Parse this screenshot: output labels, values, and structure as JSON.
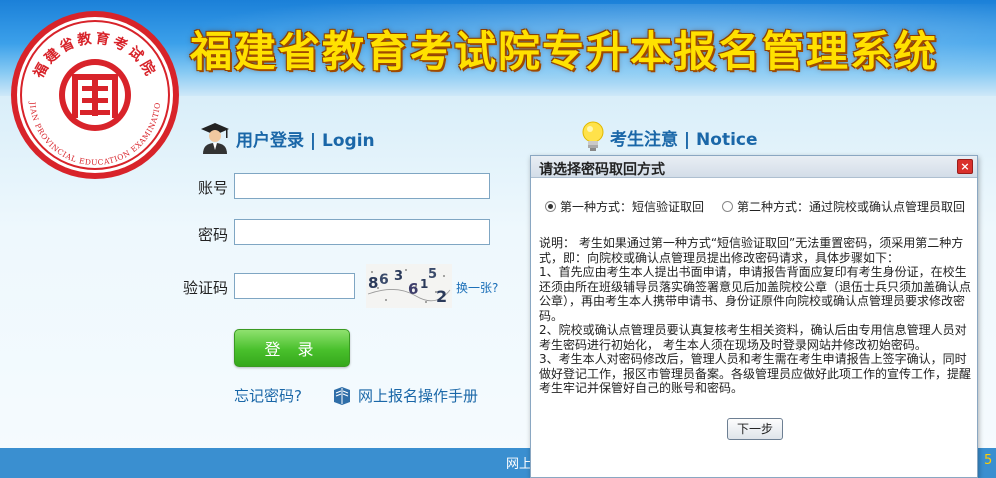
{
  "header": {
    "title": "福建省教育考试院专升本报名管理系统",
    "seal_text": "福建省教育考试院",
    "seal_text_en": "FUJIAN PROVINCIAL EDUCATION EXAMINATIONS"
  },
  "login": {
    "title": "用户登录 | Login",
    "account_label": "账号",
    "account_value": "",
    "password_label": "密码",
    "password_value": "",
    "captcha_label": "验证码",
    "captcha_value": "",
    "captcha_text": "8636152",
    "refresh_label": "换一张?",
    "submit_label": "登 录",
    "forgot_label": "忘记密码?",
    "manual_label": "网上报名操作手册"
  },
  "notice": {
    "title": "考生注意 | Notice"
  },
  "footer": {
    "text": "网上",
    "tail": "5"
  },
  "dialog": {
    "title": "请选择密码取回方式",
    "close_label": "×",
    "option1": "第一种方式：短信验证取回",
    "option2": "第二种方式：通过院校或确认点管理员取回",
    "selected": "option1",
    "body": [
      "说明：  考生如果通过第一种方式“短信验证取回”无法重置密码，须采用第二种方式，即：向院校或确认点管理员提出修改密码请求，具体步骤如下：",
      "1、首先应由考生本人提出书面申请，申请报告背面应复印有考生身份证，在校生还须由所在班级辅导员落实确签署意见后加盖院校公章（退伍士兵只须加盖确认点公章），再由考生本人携带申请书、身份证原件向院校或确认点管理员要求修改密码。",
      "2、院校或确认点管理员要认真复核考生相关资料，确认后由专用信息管理人员对考生密码进行初始化，  考生本人须在现场及时登录网站并修改初始密码。",
      "3、考生本人对密码修改后，管理人员和考生需在考生申请报告上签字确认，同时做好登记工作，报区市管理员备案。各级管理员应做好此项工作的宣传工作，提醒考生牢记并保管好自己的账号和密码。"
    ],
    "next_label": "下一步"
  },
  "colors": {
    "title_yellow": "#ffe100",
    "link_blue": "#1a67a8",
    "button_green": "#49c02c",
    "seal_red": "#d8232a"
  }
}
